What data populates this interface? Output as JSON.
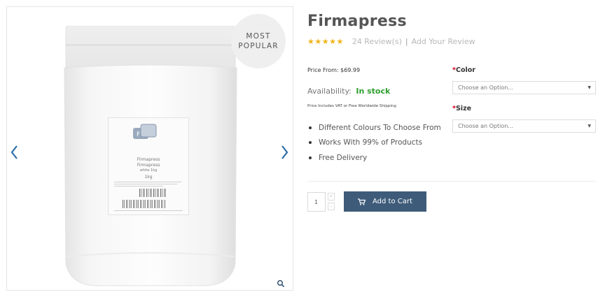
{
  "gallery": {
    "badge_line1": "MOST",
    "badge_line2": "POPULAR",
    "label": {
      "brand": "Firmapress",
      "name": "Firmapress",
      "weight_small": "white 1kg",
      "weight": "1kg"
    },
    "icons": [
      "chevron-left-icon",
      "chevron-right-icon",
      "zoom-icon"
    ]
  },
  "product": {
    "title": "Firmapress",
    "stars": "★★★★★",
    "reviews": "24 Review(s)",
    "separator": "|",
    "add_review": "Add Your Review",
    "price": "Price From: $69.99",
    "availability_label": "Availability:",
    "availability_value": "In stock",
    "vat_note": "Price Includes VAT or Free Worldwide Shipping",
    "features": [
      "Different Colours To Choose From",
      "Works With 99% of Products",
      "Free Delivery"
    ]
  },
  "options": {
    "color": {
      "required": "*",
      "label": "Color",
      "value": "Choose an Option..."
    },
    "size": {
      "required": "*",
      "label": "Size",
      "value": "Choose an Option..."
    }
  },
  "cart": {
    "quantity": "1",
    "plus": "+",
    "minus": "-",
    "button_label": "Add to Cart"
  },
  "colors": {
    "accent_button": "#3e5c7a",
    "stock_green": "#2d9e2d",
    "star": "#f0b418",
    "required": "#d0021b",
    "arrows": "#2f6fa8"
  }
}
